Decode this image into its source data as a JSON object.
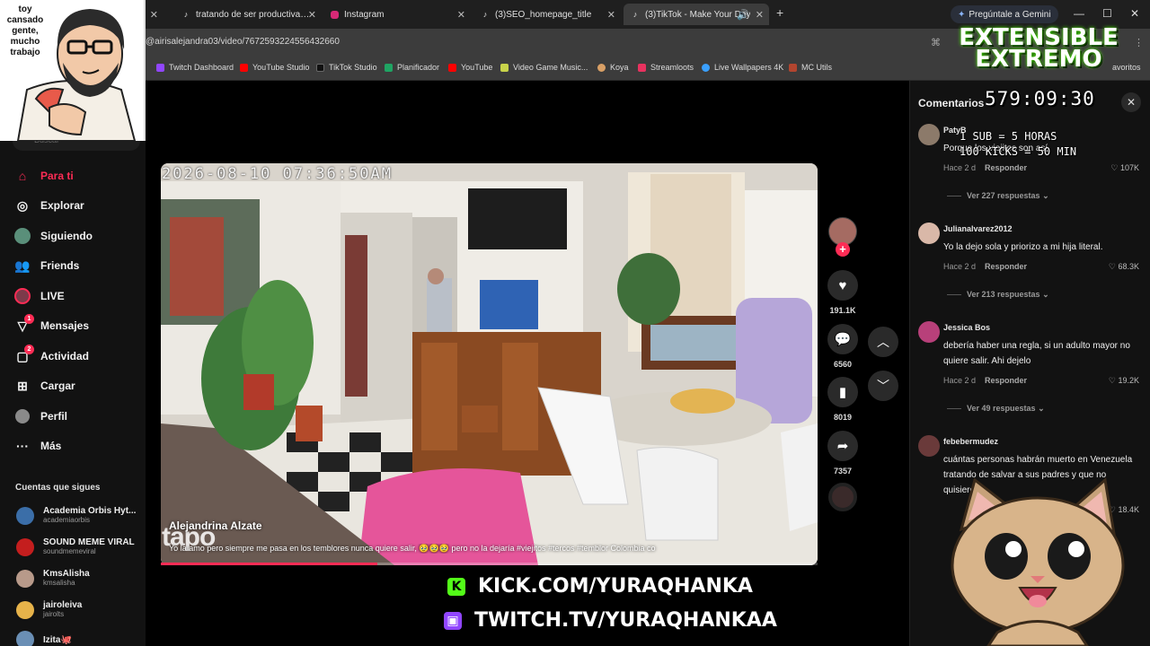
{
  "browser": {
    "tabs": [
      {
        "label": "tratando de ser productiva per",
        "icon": "tiktok-icon"
      },
      {
        "label": "Instagram",
        "icon": "instagram-icon"
      },
      {
        "label": "(3)SEO_homepage_title",
        "icon": "tiktok-icon"
      },
      {
        "label": "(3)TikTok - Make Your Day",
        "icon": "tiktok-icon"
      }
    ],
    "gemini_label": "Pregúntale a Gemini",
    "url": "@airisalejandra03/video/7672593224556432660",
    "bookmarks": [
      "Twitch Dashboard",
      "YouTube Studio",
      "TikTok Studio",
      "Planificador",
      "YouTube",
      "Video Game Music...",
      "Koya",
      "Streamloots",
      "Live Wallpapers 4K",
      "MC Utils"
    ],
    "favorites_label": "avoritos"
  },
  "sidebar": {
    "search_placeholder": "Buscar",
    "nav": [
      {
        "label": "Para ti",
        "icon": "home-icon"
      },
      {
        "label": "Explorar",
        "icon": "compass-icon"
      },
      {
        "label": "Siguiendo",
        "icon": "following-avatar-icon"
      },
      {
        "label": "Friends",
        "icon": "friends-icon"
      },
      {
        "label": "LIVE",
        "icon": "live-icon"
      },
      {
        "label": "Mensajes",
        "icon": "messages-icon",
        "badge": "1"
      },
      {
        "label": "Actividad",
        "icon": "activity-icon",
        "badge": "2"
      },
      {
        "label": "Cargar",
        "icon": "upload-icon"
      },
      {
        "label": "Perfil",
        "icon": "profile-icon"
      },
      {
        "label": "Más",
        "icon": "more-icon"
      }
    ],
    "following_title": "Cuentas que sigues",
    "accounts": [
      {
        "name": "Academia Orbis Hyt...",
        "handle": "academiaorbis"
      },
      {
        "name": "SOUND MEME VIRAL",
        "handle": "soundmemeviral"
      },
      {
        "name": "KmsAlisha",
        "handle": "kmsalisha"
      },
      {
        "name": "jairoleiva",
        "handle": "jairolts"
      },
      {
        "name": "Izita🐙",
        "handle": ""
      }
    ]
  },
  "webcam_caption": "toy cansado gente, mucho trabajo",
  "video": {
    "timestamp": "2026-08-10 07:36:50AM",
    "author": "Alejandrina Alzate",
    "description": "Yo la amo pero siempre me pasa en los temblores nunca quiere salir, 🥹🥹🥹 pero no la dejaría #viejitos #tercos #temblor Colombia co",
    "watermark": "tapo",
    "progress": 0.33
  },
  "actions": {
    "likes": "191.1K",
    "comments": "6560",
    "saves": "8019",
    "shares": "7357"
  },
  "comments": {
    "title": "Comentarios",
    "items": [
      {
        "user": "PatyB",
        "text": "Porque los viejitos son así",
        "time": "Hace 2 d",
        "reply": "Responder",
        "likes": "107K",
        "more": "Ver 227 respuestas"
      },
      {
        "user": "Julianalvarez2012",
        "text": "Yo la dejo sola y priorizo a mi hija literal.",
        "time": "Hace 2 d",
        "reply": "Responder",
        "likes": "68.3K",
        "more": "Ver 213 respuestas"
      },
      {
        "user": "Jessica Bos",
        "text": "debería haber una regla, si un adulto mayor no quiere salir. Ahi dejelo",
        "time": "Hace 2 d",
        "reply": "Responder",
        "likes": "19.2K",
        "more": "Ver 49 respuestas"
      },
      {
        "user": "febebermudez",
        "text": "cuántas personas habrán muerto en Venezuela tratando de salvar a sus padres y que no quisieron",
        "time": "",
        "reply": "",
        "likes": "18.4K",
        "more": ""
      }
    ]
  },
  "overlay": {
    "title": "EXTENSIBLE EXTREMO",
    "timer": "579:09:30",
    "rule_1": "1 SUB = 5 HORAS",
    "rule_2": "100 KICKS = 50 MIN",
    "kick": "KICK.COM/YURAQHANKA",
    "twitch": "TWITCH.TV/YURAQHANKAA",
    "kick_color": "#53fc18",
    "twitch_color": "#9146ff"
  }
}
